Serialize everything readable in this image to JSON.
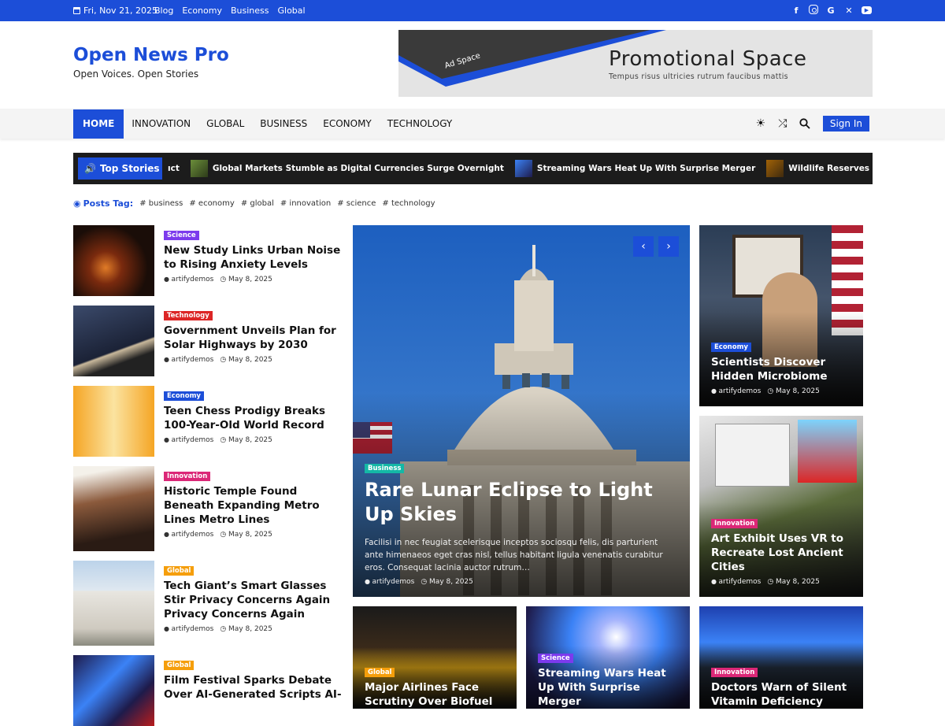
{
  "topbar": {
    "date": "Fri, Nov 21, 2025",
    "links": [
      "Blog",
      "Economy",
      "Business",
      "Global"
    ],
    "social": [
      "facebook-icon",
      "instagram-icon",
      "google-icon",
      "x-icon",
      "youtube-icon"
    ]
  },
  "brand": {
    "title": "Open News Pro",
    "tagline": "Open Voices. Open Stories"
  },
  "ad": {
    "label": "Ad Space",
    "title": "Promotional Space",
    "subtitle": "Tempus risus ultricies rutrum faucibus mattis"
  },
  "nav": {
    "items": [
      "HOME",
      "INNOVATION",
      "GLOBAL",
      "BUSINESS",
      "ECONOMY",
      "TECHNOLOGY"
    ],
    "signin": "Sign In"
  },
  "ticker": {
    "label": "Top Stories",
    "items": [
      "ıct",
      "Global Markets Stumble as Digital Currencies Surge Overnight",
      "Streaming Wars Heat Up With Surprise Merger",
      "Wildlife Reserves Report Surge in Endang"
    ]
  },
  "tags": {
    "label": "Posts Tag:",
    "items": [
      "# business",
      "# economy",
      "# global",
      "# innovation",
      "# science",
      "# technology"
    ]
  },
  "list": [
    {
      "cat": "Science",
      "color": "#7c3aed",
      "title": "New Study Links Urban Noise to Rising Anxiety Levels",
      "author": "artifydemos",
      "date": "May 8, 2025"
    },
    {
      "cat": "Technology",
      "color": "#dc2626",
      "title": "Government Unveils Plan for Solar Highways by 2030",
      "author": "artifydemos",
      "date": "May 8, 2025"
    },
    {
      "cat": "Economy",
      "color": "#1c4ed8",
      "title": "Teen Chess Prodigy Breaks 100-Year-Old World Record",
      "author": "artifydemos",
      "date": "May 8, 2025"
    },
    {
      "cat": "Innovation",
      "color": "#db2777",
      "title": "Historic Temple Found Beneath Expanding Metro Lines Metro Lines",
      "author": "artifydemos",
      "date": "May 8, 2025"
    },
    {
      "cat": "Global",
      "color": "#f59e0b",
      "title": "Tech Giant’s Smart Glasses Stir Privacy Concerns Again Privacy Concerns Again",
      "author": "artifydemos",
      "date": "May 8, 2025"
    },
    {
      "cat": "Global",
      "color": "#f59e0b",
      "title": "Film Festival Sparks Debate Over AI-Generated Scripts AI-",
      "author": "",
      "date": ""
    }
  ],
  "hero": {
    "cat": "Business",
    "color": "#14b8a6",
    "title": "Rare Lunar Eclipse to Light Up Skies",
    "excerpt": "Facilisi in nec feugiat scelerisque inceptos sociosqu felis, dis parturient ante himenaeos eget cras nisl, tellus habitant ligula venenatis curabitur eros. Consequat lacinia auctor rutrum…",
    "author": "artifydemos",
    "date": "May 8, 2025"
  },
  "side": [
    {
      "cat": "Economy",
      "color": "#1c4ed8",
      "title": "Scientists Discover Hidden Microbiome",
      "author": "artifydemos",
      "date": "May 8, 2025"
    },
    {
      "cat": "Innovation",
      "color": "#db2777",
      "title": "Art Exhibit Uses VR to Recreate Lost Ancient Cities",
      "author": "artifydemos",
      "date": "May 8, 2025"
    }
  ],
  "bottom": [
    {
      "cat": "Global",
      "color": "#f59e0b",
      "title": "Major Airlines Face Scrutiny Over Biofuel"
    },
    {
      "cat": "Science",
      "color": "#7c3aed",
      "title": "Streaming Wars Heat Up With Surprise Merger"
    },
    {
      "cat": "Innovation",
      "color": "#db2777",
      "title": "Doctors Warn of Silent Vitamin Deficiency"
    }
  ]
}
